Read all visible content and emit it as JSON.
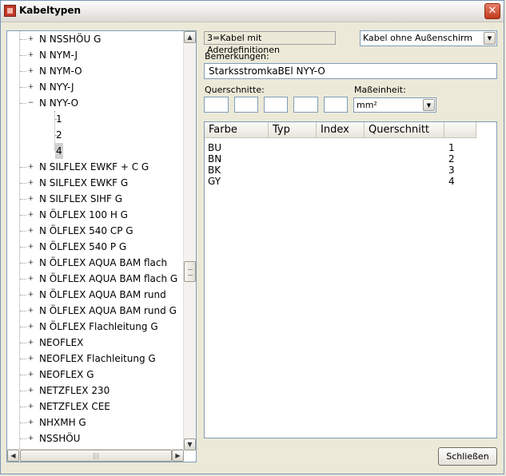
{
  "window": {
    "title": "Kabeltypen",
    "close_glyph": "✕"
  },
  "tree": {
    "items": [
      {
        "label": "N NSSHÖU G",
        "exp": "+",
        "level": 0
      },
      {
        "label": "N NYM-J",
        "exp": "+",
        "level": 0
      },
      {
        "label": "N NYM-O",
        "exp": "+",
        "level": 0
      },
      {
        "label": "N NYY-J",
        "exp": "+",
        "level": 0
      },
      {
        "label": "N NYY-O",
        "exp": "−",
        "level": 0
      },
      {
        "label": "1",
        "exp": "",
        "level": 1
      },
      {
        "label": "2",
        "exp": "",
        "level": 1
      },
      {
        "label": "4",
        "exp": "",
        "level": 1,
        "selected": true
      },
      {
        "label": "N SILFLEX EWKF + C G",
        "exp": "+",
        "level": 0
      },
      {
        "label": "N SILFLEX EWKF G",
        "exp": "+",
        "level": 0
      },
      {
        "label": "N SILFLEX SIHF G",
        "exp": "+",
        "level": 0
      },
      {
        "label": "N ÖLFLEX 100 H G",
        "exp": "+",
        "level": 0
      },
      {
        "label": "N ÖLFLEX 540 CP G",
        "exp": "+",
        "level": 0
      },
      {
        "label": "N ÖLFLEX 540 P G",
        "exp": "+",
        "level": 0
      },
      {
        "label": "N ÖLFLEX AQUA BAM flach",
        "exp": "+",
        "level": 0
      },
      {
        "label": "N ÖLFLEX AQUA BAM flach G",
        "exp": "+",
        "level": 0
      },
      {
        "label": "N ÖLFLEX AQUA BAM rund",
        "exp": "+",
        "level": 0
      },
      {
        "label": "N ÖLFLEX AQUA BAM rund G",
        "exp": "+",
        "level": 0
      },
      {
        "label": "N ÖLFLEX Flachleitung G",
        "exp": "+",
        "level": 0
      },
      {
        "label": "NEOFLEX",
        "exp": "+",
        "level": 0
      },
      {
        "label": "NEOFLEX Flachleitung G",
        "exp": "+",
        "level": 0
      },
      {
        "label": "NEOFLEX G",
        "exp": "+",
        "level": 0
      },
      {
        "label": "NETZFLEX 230",
        "exp": "+",
        "level": 0
      },
      {
        "label": "NETZFLEX CEE",
        "exp": "+",
        "level": 0
      },
      {
        "label": "NHXMH G",
        "exp": "+",
        "level": 0
      },
      {
        "label": "NSSHÖU",
        "exp": "+",
        "level": 0
      }
    ],
    "scroll_up": "▲",
    "scroll_down": "▼",
    "scroll_left": "◀",
    "scroll_right": "▶",
    "hthumb_grip": "|||"
  },
  "info_text": "3=Kabel mit Aderdefinitionen",
  "sheath": {
    "value": "Kabel ohne Außenschirm",
    "arrow": "▼"
  },
  "remarks": {
    "label": "Bemerkungen:",
    "value": "StarksstromkaBEl NYY-O"
  },
  "cross_sections": {
    "label": "Querschnitte:",
    "values": [
      "",
      "",
      "",
      "",
      ""
    ]
  },
  "unit": {
    "label": "Maßeinheit:",
    "value": "mm²",
    "arrow": "▼"
  },
  "list": {
    "columns": [
      "Farbe",
      "Typ",
      "Index",
      "Querschnitt",
      ""
    ],
    "rows": [
      {
        "farbe": "BU",
        "typ": "",
        "index": "",
        "querschnitt": "1"
      },
      {
        "farbe": "BN",
        "typ": "",
        "index": "",
        "querschnitt": "2"
      },
      {
        "farbe": "BK",
        "typ": "",
        "index": "",
        "querschnitt": "3"
      },
      {
        "farbe": "GY",
        "typ": "",
        "index": "",
        "querschnitt": "4"
      }
    ]
  },
  "close_button": "Schließen"
}
